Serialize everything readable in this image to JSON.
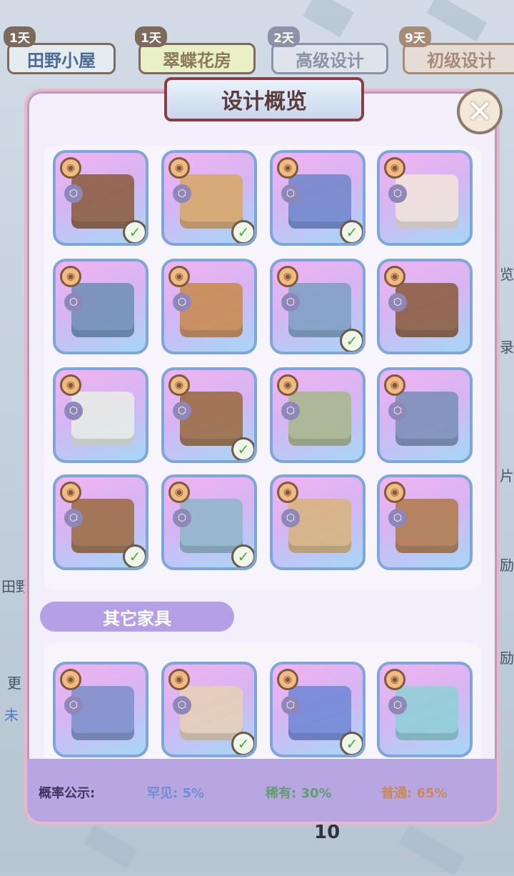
{
  "tabs": [
    {
      "days": "1天",
      "label": "田野小屋"
    },
    {
      "days": "1天",
      "label": "翠蝶花房"
    },
    {
      "days": "2天",
      "label": "高级设计"
    },
    {
      "days": "9天",
      "label": "初级设计"
    }
  ],
  "background_fragments": [
    "览",
    "录",
    "片",
    "励",
    "励",
    "田野",
    "更",
    "未",
    "10"
  ],
  "title": "设计概览",
  "close_glyph": "✕",
  "section_other": "其它家具",
  "footer": {
    "label": "概率公示:",
    "rare_label": "罕见: 5%",
    "uncommon_label": "稀有: 30%",
    "common_label": "普通: 65%",
    "rare_color": "#6f8fd0",
    "uncommon_color": "#5f9e6a",
    "common_color": "#c88a52"
  },
  "design_items": [
    {
      "icon": "feast-table-icon",
      "collected": true
    },
    {
      "icon": "wood-plank-floor-icon",
      "collected": true
    },
    {
      "icon": "blue-flower-planter-icon",
      "collected": true
    },
    {
      "icon": "curtain-doorway-icon",
      "collected": false
    },
    {
      "icon": "cushioned-daybed-icon",
      "collected": false
    },
    {
      "icon": "wood-beam-icon",
      "collected": false
    },
    {
      "icon": "cushioned-chair-icon",
      "collected": true
    },
    {
      "icon": "wooden-armchair-icon",
      "collected": false
    },
    {
      "icon": "round-tablecloth-table-icon",
      "collected": false
    },
    {
      "icon": "garden-fence-gate-icon",
      "collected": true
    },
    {
      "icon": "stone-garden-patch-icon",
      "collected": false
    },
    {
      "icon": "flower-window-awning-icon",
      "collected": false
    },
    {
      "icon": "flower-wall-panel-icon",
      "collected": true
    },
    {
      "icon": "stained-glass-panel-icon",
      "collected": true
    },
    {
      "icon": "framed-window-icon",
      "collected": false
    },
    {
      "icon": "wooden-door-panel-icon",
      "collected": false
    }
  ],
  "other_items": [
    {
      "icon": "blue-petal-rug-icon",
      "collected": false
    },
    {
      "icon": "flowered-fence-icon",
      "collected": true
    },
    {
      "icon": "hydrangea-bush-icon",
      "collected": true
    },
    {
      "icon": "water-pond-deck-icon",
      "collected": false
    }
  ]
}
